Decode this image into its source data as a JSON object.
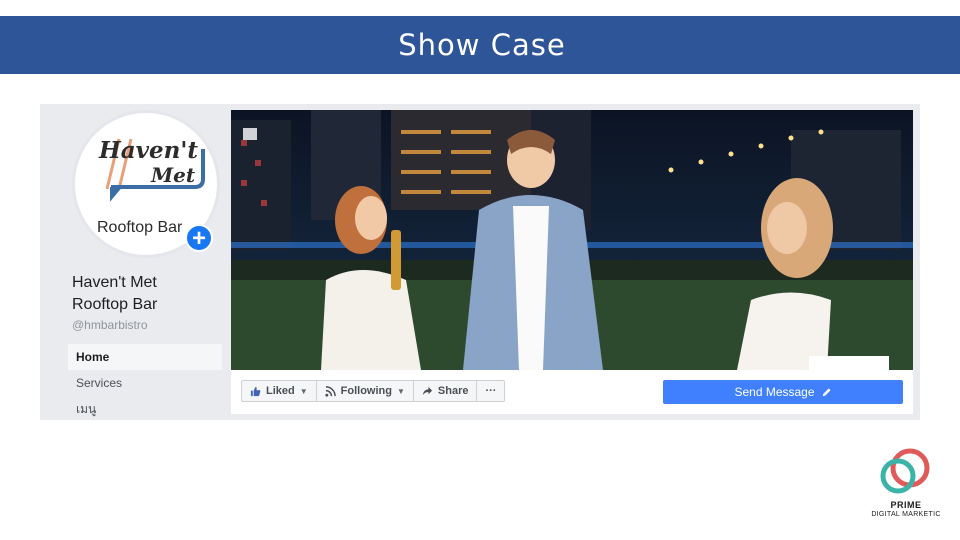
{
  "slide": {
    "title": "Show Case"
  },
  "page": {
    "name_line1": "Haven't Met",
    "name_line2": "Rooftop Bar",
    "handle": "@hmbarbistro",
    "logo": {
      "line1": "Haven't",
      "line2": "Met",
      "line3": "Rooftop Bar"
    },
    "add_icon": "plus-icon"
  },
  "nav": {
    "items": [
      {
        "label": "Home",
        "active": true
      },
      {
        "label": "Services",
        "active": false
      },
      {
        "label": "เมนู",
        "active": false
      }
    ]
  },
  "actions": {
    "liked_label": "Liked",
    "following_label": "Following",
    "share_label": "Share",
    "more_label": "···",
    "send_label": "Send Message"
  },
  "brand": {
    "line1": "PRIME",
    "line2": "DIGITAL MARKETIC"
  },
  "colors": {
    "banner": "#2d5597",
    "fb_blue": "#4080ff",
    "accent_red": "#e05a5a",
    "accent_teal": "#3bb3a9"
  }
}
